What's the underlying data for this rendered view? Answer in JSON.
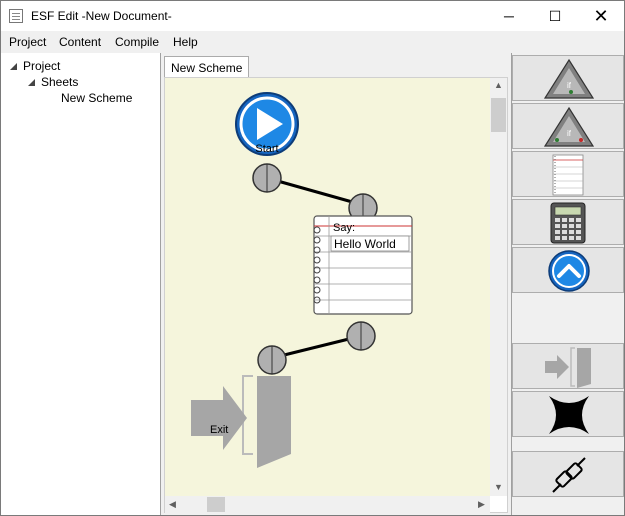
{
  "window": {
    "title": "ESF Edit -New Document-",
    "controls": {
      "minimize": "─",
      "maximize": "☐",
      "close": "✕"
    }
  },
  "menu": {
    "items": [
      {
        "label": "Project"
      },
      {
        "label": "Content"
      },
      {
        "label": "Compile"
      },
      {
        "label": "Help"
      }
    ]
  },
  "tree": {
    "root": "Project",
    "sheets": "Sheets",
    "scheme": "New Scheme"
  },
  "tabs": [
    {
      "label": "New Scheme"
    }
  ],
  "canvas": {
    "background": "#f5f5dc",
    "start_node": {
      "label": "Start",
      "color": "#1565c0"
    },
    "say_node": {
      "label": "Say:",
      "value": "Hello World"
    },
    "exit_node": {
      "label": "Exit"
    }
  },
  "toolbar": {
    "tools": [
      {
        "name": "if-node-tool",
        "icon": "if-triangle-icon"
      },
      {
        "name": "if-else-node-tool",
        "icon": "if-else-triangle-icon"
      },
      {
        "name": "text-node-tool",
        "icon": "notebook-icon"
      },
      {
        "name": "calculator-tool",
        "icon": "calculator-icon"
      },
      {
        "name": "jump-up-tool",
        "icon": "chevron-up-icon"
      },
      {
        "name": "exit-tool",
        "icon": "exit-door-icon"
      },
      {
        "name": "delete-tool",
        "icon": "delete-x-icon"
      },
      {
        "name": "disconnect-tool",
        "icon": "unplug-icon"
      }
    ]
  }
}
